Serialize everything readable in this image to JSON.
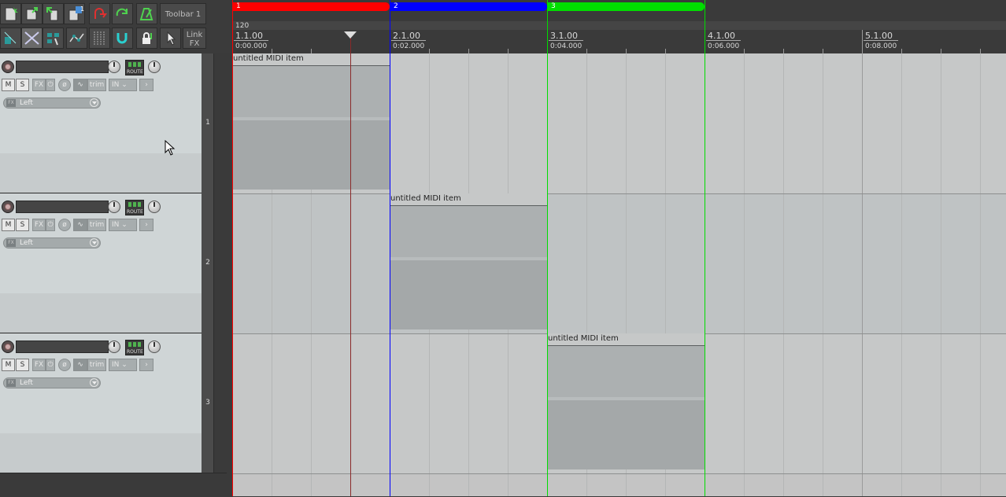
{
  "toolbar": {
    "label": "Toolbar 1",
    "link_fx": "Link FX",
    "badge": "1"
  },
  "tracks": [
    {
      "number": "1",
      "mute": "M",
      "solo": "S",
      "fx": "FX",
      "trim": "trim",
      "input": "IN",
      "route": "ROUTE",
      "input_channel": "Left"
    },
    {
      "number": "2",
      "mute": "M",
      "solo": "S",
      "fx": "FX",
      "trim": "trim",
      "input": "IN",
      "route": "ROUTE",
      "input_channel": "Left"
    },
    {
      "number": "3",
      "mute": "M",
      "solo": "S",
      "fx": "FX",
      "trim": "trim",
      "input": "IN",
      "route": "ROUTE",
      "input_channel": "Left"
    }
  ],
  "regions": [
    {
      "label": "1",
      "color": "#ff0000"
    },
    {
      "label": "2",
      "color": "#0000ff"
    },
    {
      "label": "3",
      "color": "#00dd00"
    }
  ],
  "tempo": "120",
  "ruler": [
    {
      "measure": "1.1.00",
      "time": "0:00.000"
    },
    {
      "measure": "2.1.00",
      "time": "0:02.000"
    },
    {
      "measure": "3.1.00",
      "time": "0:04.000"
    },
    {
      "measure": "4.1.00",
      "time": "0:06.000"
    },
    {
      "measure": "5.1.00",
      "time": "0:08.000"
    }
  ],
  "items": [
    {
      "title": "untitled MIDI item"
    },
    {
      "title": "untitled MIDI item"
    },
    {
      "title": "untitled MIDI item"
    }
  ]
}
